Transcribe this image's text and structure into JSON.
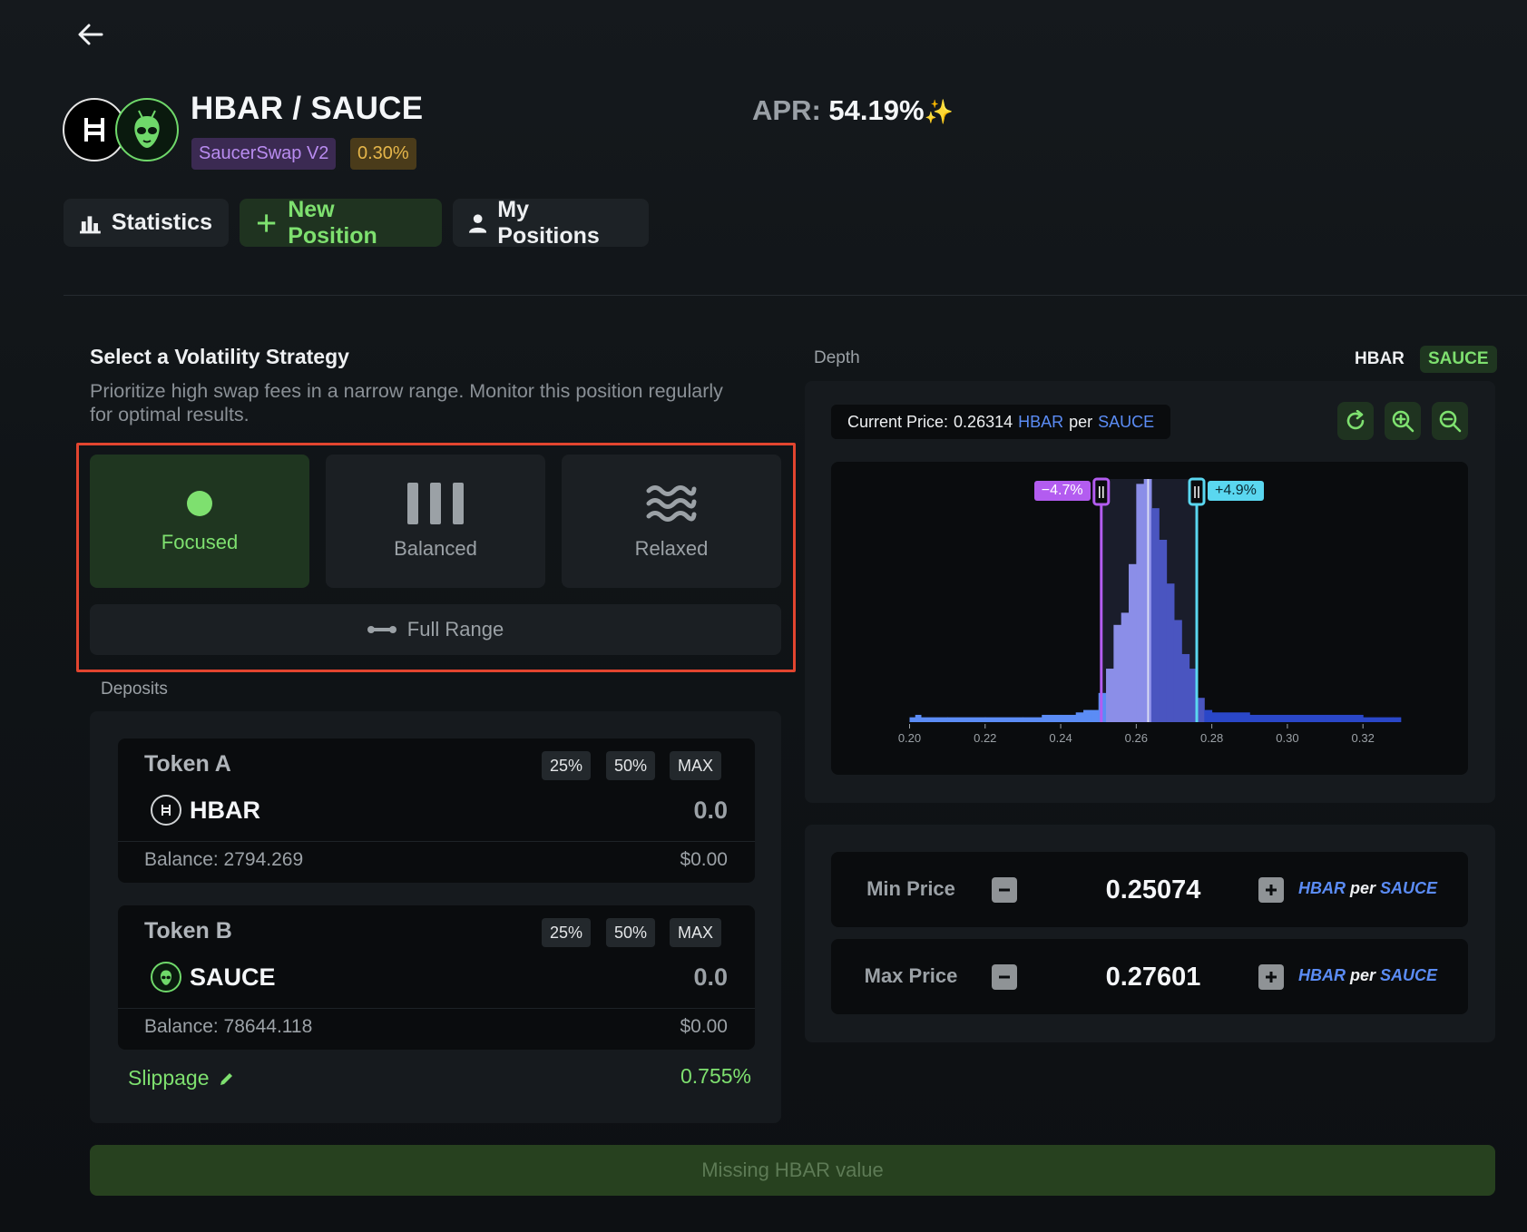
{
  "header": {
    "pair": "HBAR / SAUCE",
    "dex": "SaucerSwap V2",
    "fee": "0.30%",
    "apr_label": "APR:",
    "apr_value": "54.19%",
    "apr_sparkle": "✨"
  },
  "tabs": [
    {
      "label": "Statistics",
      "icon": "bar-chart-icon"
    },
    {
      "label": "New Position",
      "icon": "plus-icon"
    },
    {
      "label": "My Positions",
      "icon": "user-icon"
    }
  ],
  "strategy": {
    "title": "Select a Volatility Strategy",
    "description": "Prioritize high swap fees in a narrow range. Monitor this position regularly for optimal results.",
    "options": [
      {
        "label": "Focused",
        "icon": "dot-icon",
        "selected": true
      },
      {
        "label": "Balanced",
        "icon": "bars-icon",
        "selected": false
      },
      {
        "label": "Relaxed",
        "icon": "waves-icon",
        "selected": false
      }
    ],
    "full_range": "Full Range",
    "highlight_color": "#e2452f"
  },
  "deposits": {
    "label": "Deposits",
    "tokens": [
      {
        "label": "Token A",
        "symbol": "HBAR",
        "amount": "0.0",
        "balance": "Balance: 2794.269",
        "usd": "$0.00"
      },
      {
        "label": "Token B",
        "symbol": "SAUCE",
        "amount": "0.0",
        "balance": "Balance: 78644.118",
        "usd": "$0.00"
      }
    ],
    "pct_buttons": [
      "25%",
      "50%",
      "MAX"
    ],
    "slippage_label": "Slippage",
    "slippage_value": "0.755%"
  },
  "depth": {
    "label": "Depth",
    "toggle": [
      "HBAR",
      "SAUCE"
    ],
    "current_price_label": "Current Price:",
    "current_price": "0.26314",
    "unit_base": "HBAR",
    "unit_per": "per",
    "unit_quote": "SAUCE",
    "range_low_badge": "−4.7%",
    "range_high_badge": "+4.9%"
  },
  "chart_data": {
    "type": "bar",
    "title": "",
    "xlabel": "",
    "ylabel": "",
    "xlim": [
      0.197,
      0.331
    ],
    "x_ticks": [
      "0.20",
      "0.22",
      "0.24",
      "0.26",
      "0.28",
      "0.30",
      "0.32"
    ],
    "x_tick_values": [
      0.2,
      0.22,
      0.24,
      0.26,
      0.28,
      0.3,
      0.32
    ],
    "current_price": 0.26314,
    "range_min": 0.25074,
    "range_max": 0.27601,
    "bins": [
      {
        "x": 0.2,
        "h": 2
      },
      {
        "x": 0.2015,
        "h": 3
      },
      {
        "x": 0.203,
        "h": 2
      },
      {
        "x": 0.21,
        "h": 2
      },
      {
        "x": 0.22,
        "h": 2
      },
      {
        "x": 0.23,
        "h": 2
      },
      {
        "x": 0.235,
        "h": 3
      },
      {
        "x": 0.24,
        "h": 3
      },
      {
        "x": 0.244,
        "h": 4
      },
      {
        "x": 0.246,
        "h": 5
      },
      {
        "x": 0.248,
        "h": 5
      },
      {
        "x": 0.25,
        "h": 12
      },
      {
        "x": 0.252,
        "h": 22
      },
      {
        "x": 0.254,
        "h": 40
      },
      {
        "x": 0.256,
        "h": 45
      },
      {
        "x": 0.258,
        "h": 65
      },
      {
        "x": 0.26,
        "h": 98
      },
      {
        "x": 0.262,
        "h": 100
      },
      {
        "x": 0.264,
        "h": 88
      },
      {
        "x": 0.266,
        "h": 75
      },
      {
        "x": 0.268,
        "h": 57
      },
      {
        "x": 0.27,
        "h": 42
      },
      {
        "x": 0.272,
        "h": 28
      },
      {
        "x": 0.274,
        "h": 22
      },
      {
        "x": 0.276,
        "h": 10
      },
      {
        "x": 0.278,
        "h": 5
      },
      {
        "x": 0.28,
        "h": 4
      },
      {
        "x": 0.29,
        "h": 3
      },
      {
        "x": 0.3,
        "h": 3
      },
      {
        "x": 0.31,
        "h": 3
      },
      {
        "x": 0.32,
        "h": 2
      },
      {
        "x": 0.328,
        "h": 2
      }
    ],
    "colors": {
      "left": "#5b8cf5",
      "range_left": "#8b8ee8",
      "range_right": "#4a55c0",
      "right": "#2a47c8",
      "min_handle": "#b35cf0",
      "max_handle": "#5ad7f0"
    }
  },
  "price_range": {
    "min_label": "Min Price",
    "min_value": "0.25074",
    "max_label": "Max Price",
    "max_value": "0.27601",
    "unit_base": "HBAR",
    "unit_per": "per",
    "unit_quote": "SAUCE"
  },
  "submit_label": "Missing HBAR value",
  "colors": {
    "accent": "#7ee06f",
    "blue": "#5b8cf5",
    "purple": "#b98cf0",
    "gold": "#e6b64a"
  }
}
